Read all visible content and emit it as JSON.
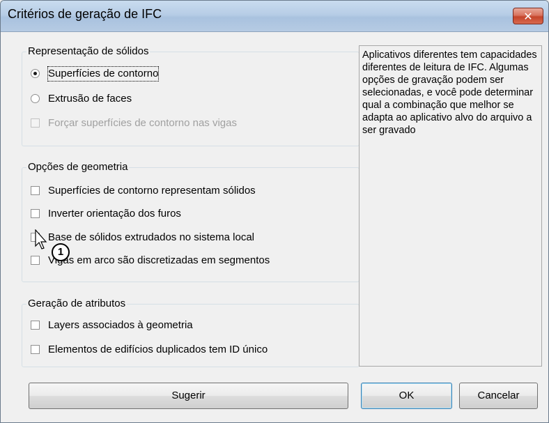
{
  "window": {
    "title": "Critérios de geração de IFC",
    "close_glyph": "✕"
  },
  "groups": {
    "solids": {
      "title": "Representação de sólidos",
      "options": [
        {
          "label": "Superfícies de contorno",
          "type": "radio",
          "checked": true,
          "enabled": true
        },
        {
          "label": "Extrusão de faces",
          "type": "radio",
          "checked": false,
          "enabled": true
        },
        {
          "label": "Forçar superfícies de contorno nas vigas",
          "type": "checkbox",
          "checked": false,
          "enabled": false
        }
      ]
    },
    "geometry": {
      "title": "Opções de geometria",
      "options": [
        {
          "label": "Superfícies de contorno representam sólidos",
          "type": "checkbox",
          "checked": false,
          "enabled": true
        },
        {
          "label": "Inverter orientação dos furos",
          "type": "checkbox",
          "checked": false,
          "enabled": true
        },
        {
          "label": "Base de sólidos extrudados no sistema local",
          "type": "checkbox",
          "checked": false,
          "enabled": true
        },
        {
          "label": "Vigas em arco são discretizadas em segmentos",
          "type": "checkbox",
          "checked": false,
          "enabled": true
        }
      ]
    },
    "attributes": {
      "title": "Geração de atributos",
      "options": [
        {
          "label": "Layers associados à geometria",
          "type": "checkbox",
          "checked": false,
          "enabled": true
        },
        {
          "label": "Elementos de edifícios duplicados tem ID único",
          "type": "checkbox",
          "checked": false,
          "enabled": true
        }
      ]
    }
  },
  "info_text": "Aplicativos diferentes tem capacidades diferentes de leitura de IFC. Algumas opções de gravação podem ser selecionadas, e você pode determinar qual a combinação que melhor se adapta ao aplicativo alvo do arquivo a ser gravado",
  "buttons": {
    "suggest": "Sugerir",
    "ok": "OK",
    "cancel": "Cancelar"
  },
  "callout_badge": "1",
  "colors": {
    "close_button": "#c4442b",
    "title_bar": "#b7cde6",
    "default_button_border": "#3c7fb1"
  },
  "icons": [
    "close-icon",
    "mouse-cursor-icon"
  ]
}
